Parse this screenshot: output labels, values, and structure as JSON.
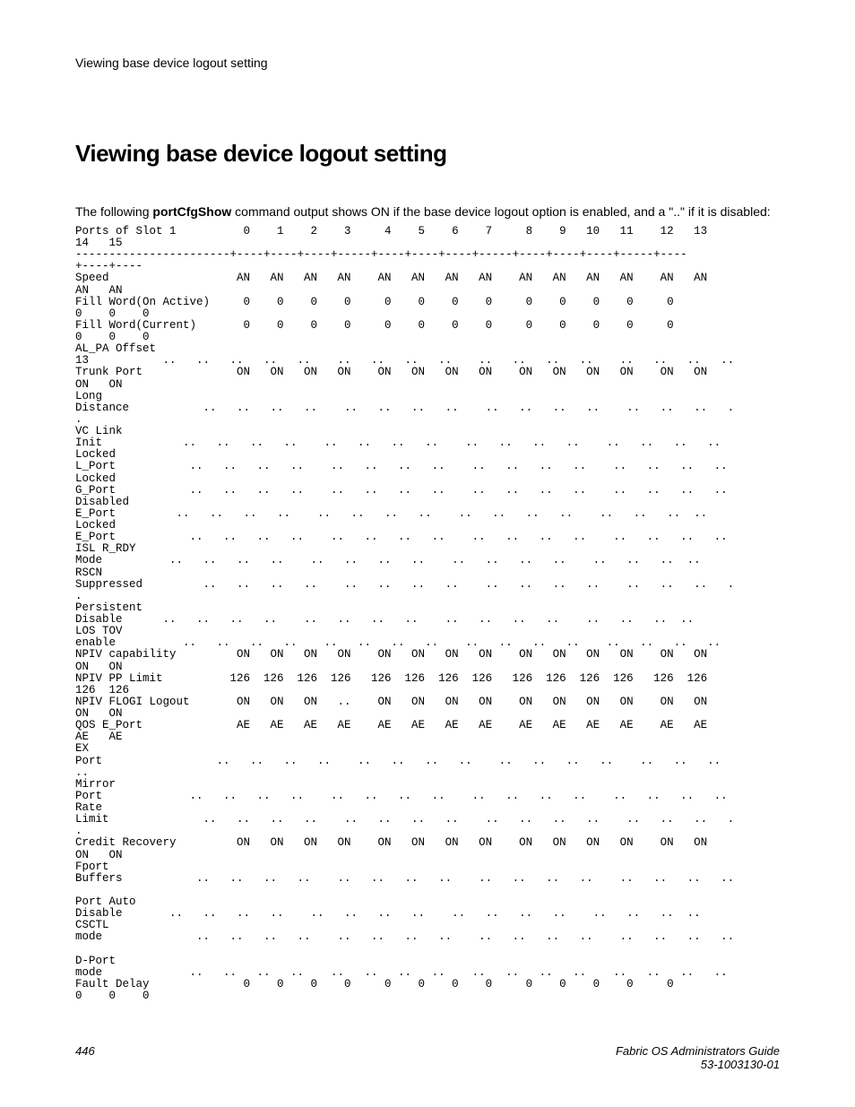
{
  "running_header": "Viewing base device logout setting",
  "title": "Viewing base device logout setting",
  "intro_pre": "The following ",
  "intro_cmd": "portCfgShow",
  "intro_post": " command output shows ON if the base device logout option is enabled, and a \"..\" if it is disabled:",
  "code": "Ports of Slot 1          0    1    2    3     4    5    6    7     8    9   10   11    12   13   \n14   15\n-----------------------+----+----+----+-----+----+----+----+-----+----+----+----+-----+----\n+----+----\nSpeed                   AN   AN   AN   AN    AN   AN   AN   AN    AN   AN   AN   AN    AN   AN   \nAN   AN\nFill Word(On Active)     0    0    0    0     0    0    0    0     0    0    0    0     0    \n0    0    0\nFill Word(Current)       0    0    0    0     0    0    0    0     0    0    0    0     0    \n0    0    0\nAL_PA Offset \n13           ..   ..   ..   ..   ..    ..   ..   ..   ..    ..   ..   ..   ..    ..   ..   ..   ..\nTrunk Port              ON   ON   ON   ON    ON   ON   ON   ON    ON   ON   ON   ON    ON   ON   \nON   ON\nLong \nDistance           ..   ..   ..   ..    ..   ..   ..   ..    ..   ..   ..   ..    ..   ..   ..   .\n.\nVC Link \nInit            ..   ..   ..   ..    ..   ..   ..   ..    ..   ..   ..   ..    ..   ..   ..   ..\nLocked \nL_Port           ..   ..   ..   ..    ..   ..   ..   ..    ..   ..   ..   ..    ..   ..   ..   ..\nLocked \nG_Port           ..   ..   ..   ..    ..   ..   ..   ..    ..   ..   ..   ..    ..   ..   ..   ..\nDisabled \nE_Port         ..   ..   ..   ..    ..   ..   ..   ..    ..   ..   ..   ..    ..   ..   ..  ..\nLocked \nE_Port           ..   ..   ..   ..    ..   ..   ..   ..    ..   ..   ..   ..    ..   ..   ..   ..\nISL R_RDY \nMode          ..   ..   ..   ..    ..   ..   ..   ..    ..   ..   ..   ..    ..   ..   ..  ..\nRSCN \nSuppressed         ..   ..   ..   ..    ..   ..   ..   ..    ..   ..   ..   ..    ..   ..   ..   .\n.\nPersistent \nDisable      ..   ..   ..   ..    ..   ..   ..   ..    ..   ..   ..   ..    ..   ..   ..  ..\nLOS TOV \nenable          ..   ..   ..   ..    ..   ..   ..   ..    ..   ..   ..   ..    ..   ..   ..   ..\nNPIV capability         ON   ON   ON   ON    ON   ON   ON   ON    ON   ON   ON   ON    ON   ON   \nON   ON\nNPIV PP Limit          126  126  126  126   126  126  126  126   126  126  126  126   126  126  \n126  126\nNPIV FLOGI Logout       ON   ON   ON   ..    ON   ON   ON   ON    ON   ON   ON   ON    ON   ON   \nON   ON\nQOS E_Port              AE   AE   AE   AE    AE   AE   AE   AE    AE   AE   AE   AE    AE   AE   \nAE   AE\nEX \nPort                 ..   ..   ..   ..    ..   ..   ..   ..    ..   ..   ..   ..    ..   ..   ..   \n..\nMirror \nPort             ..   ..   ..   ..    ..   ..   ..   ..    ..   ..   ..   ..    ..   ..   ..   ..\nRate \nLimit              ..   ..   ..   ..    ..   ..   ..   ..    ..   ..   ..   ..    ..   ..   ..   .\n.\nCredit Recovery         ON   ON   ON   ON    ON   ON   ON   ON    ON   ON   ON   ON    ON   ON   \nON   ON\nFport \nBuffers           ..   ..   ..   ..    ..   ..   ..   ..    ..   ..   ..   ..    ..   ..   ..   ..\n\nPort Auto \nDisable       ..   ..   ..   ..    ..   ..   ..   ..    ..   ..   ..   ..    ..   ..   ..  ..\nCSCTL \nmode              ..   ..   ..   ..    ..   ..   ..   ..    ..   ..   ..   ..    ..   ..   ..   ..\n\nD-Port \nmode             ..   ..   ..   ..    ..   ..   ..   ..    ..   ..   ..   ..    ..   ..   ..   ..\nFault Delay              0    0    0    0     0    0    0    0     0    0    0    0     0    \n0    0    0",
  "footer_page": "446",
  "footer_guide": "Fabric OS Administrators Guide",
  "footer_doc": "53-1003130-01"
}
